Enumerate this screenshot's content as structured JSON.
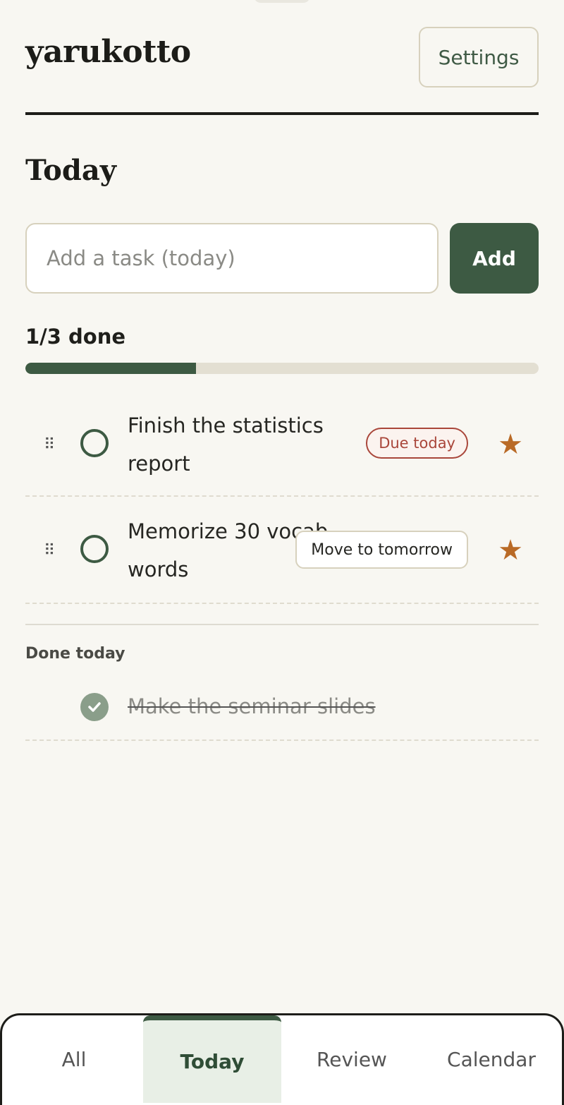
{
  "app": {
    "title": "yarukotto",
    "settings_label": "Settings"
  },
  "page": {
    "title": "Today"
  },
  "add_task": {
    "placeholder": "Add a task (today)",
    "value": "",
    "button_label": "Add"
  },
  "progress": {
    "label": "1/3 done",
    "fraction": 0.333
  },
  "tasks": [
    {
      "text": "Finish the statistics report",
      "badge": "Due today",
      "badge_type": "due",
      "starred": true,
      "done": false
    },
    {
      "text": "Memorize 30 vocab words",
      "badge": "Move to tomorrow",
      "badge_type": "action",
      "starred": true,
      "done": false
    }
  ],
  "done_section": {
    "title": "Done today",
    "items": [
      {
        "text": "Make the seminar slides",
        "done": true
      }
    ]
  },
  "tabs": [
    {
      "label": "All",
      "active": false
    },
    {
      "label": "Today",
      "active": true
    },
    {
      "label": "Review",
      "active": false
    },
    {
      "label": "Calendar",
      "active": false
    }
  ],
  "colors": {
    "accent": "#3d5a43",
    "due": "#a9463a",
    "star": "#b96a26",
    "background": "#f8f7f2"
  },
  "icons": {
    "drag": "drag-handle-icon",
    "star": "star-icon",
    "check": "check-icon",
    "circle": "unchecked-circle-icon"
  }
}
